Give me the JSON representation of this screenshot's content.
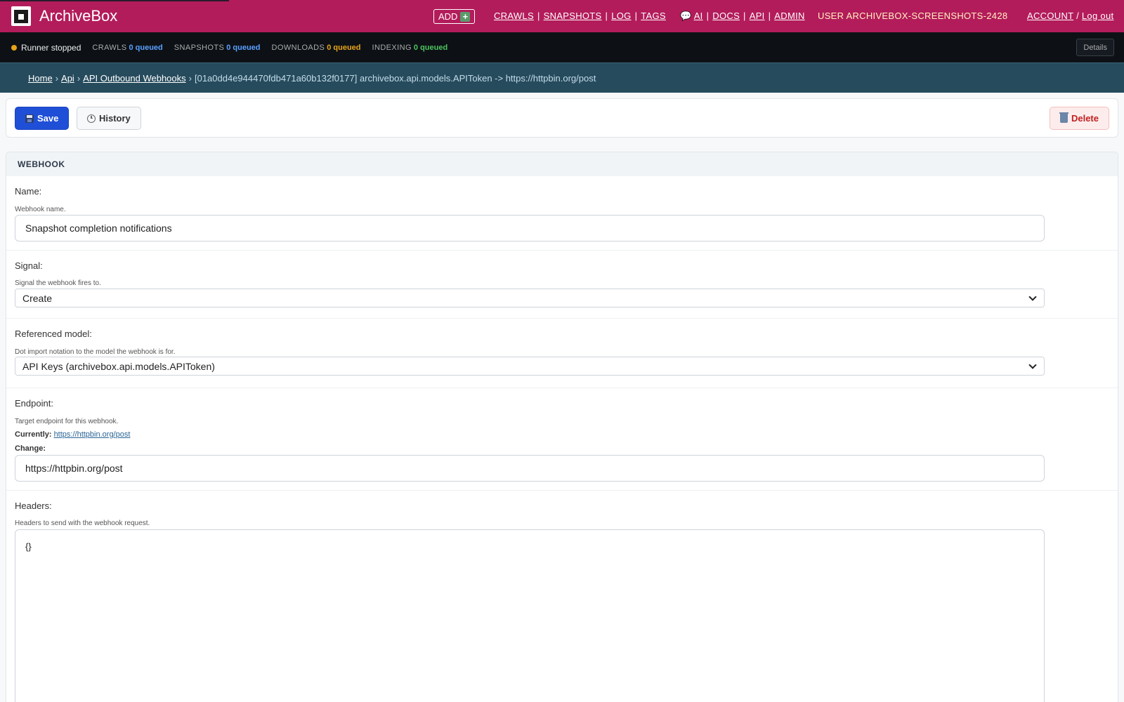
{
  "header": {
    "brand": "ArchiveBox",
    "add_label": "ADD",
    "nav_main": [
      "CRAWLS",
      "SNAPSHOTS",
      "LOG",
      "TAGS"
    ],
    "nav_ai_icon_label": "AI",
    "nav_secondary": [
      "DOCS",
      "API",
      "ADMIN"
    ],
    "user_label": "USER ARCHIVEBOX-SCREENSHOTS-2428",
    "account_label": "ACCOUNT",
    "logout_label": "Log out"
  },
  "status": {
    "runner": "Runner stopped",
    "stats": [
      {
        "label": "CRAWLS",
        "value": "0 queued",
        "color": "#5aa0ff"
      },
      {
        "label": "SNAPSHOTS",
        "value": "0 queued",
        "color": "#5aa0ff"
      },
      {
        "label": "DOWNLOADS",
        "value": "0 queued",
        "color": "#e8a317"
      },
      {
        "label": "INDEXING",
        "value": "0 queued",
        "color": "#4cc45c"
      }
    ],
    "details_label": "Details"
  },
  "breadcrumbs": {
    "links": [
      "Home",
      "Api",
      "API Outbound Webhooks"
    ],
    "current": "[01a0dd4e944470fdb471a60b132f0177] archivebox.api.models.APIToken -> https://httpbin.org/post"
  },
  "toolbar": {
    "save_label": "Save",
    "history_label": "History",
    "delete_label": "Delete"
  },
  "form": {
    "section_title": "WEBHOOK",
    "name": {
      "label": "Name:",
      "help": "Webhook name.",
      "value": "Snapshot completion notifications"
    },
    "signal": {
      "label": "Signal:",
      "help": "Signal the webhook fires to.",
      "value": "Create"
    },
    "ref_model": {
      "label": "Referenced model:",
      "help": "Dot import notation to the model the webhook is for.",
      "value": "API Keys (archivebox.api.models.APIToken)"
    },
    "endpoint": {
      "label": "Endpoint:",
      "help": "Target endpoint for this webhook.",
      "currently_label": "Currently:",
      "currently_value": "https://httpbin.org/post",
      "change_label": "Change:",
      "value": "https://httpbin.org/post"
    },
    "headers": {
      "label": "Headers:",
      "help": "Headers to send with the webhook request.",
      "value": "{}"
    }
  }
}
